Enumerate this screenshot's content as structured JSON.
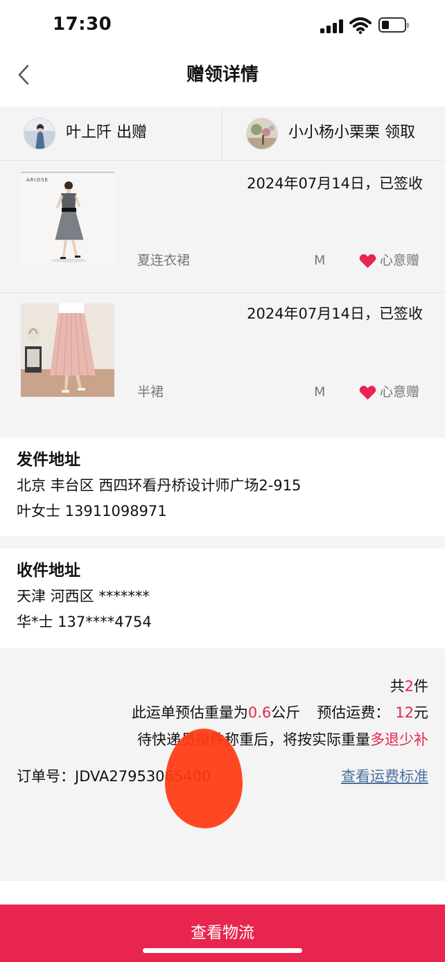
{
  "status_bar": {
    "time": "17:30"
  },
  "nav": {
    "title": "赠领详情"
  },
  "parties": {
    "giver": "叶上阡 出赠",
    "receiver": "小小杨小栗栗 领取"
  },
  "products": [
    {
      "date_status": "2024年07月14日，已签收",
      "name": "夏连衣裙",
      "size": "M",
      "tag": "心意赠",
      "image_brand": "ARIOSE"
    },
    {
      "date_status": "2024年07月14日，已签收",
      "name": "半裙",
      "size": "M",
      "tag": "心意赠"
    }
  ],
  "sender_address": {
    "title": "发件地址",
    "line1": "北京 丰台区 西四环看丹桥设计师广场2-915",
    "line2": "叶女士 13911098971"
  },
  "receiver_address": {
    "title": "收件地址",
    "line1": "天津 河西区 *******",
    "line2": "华*士 137****4754"
  },
  "summary": {
    "count_prefix": "共",
    "count": "2",
    "count_suffix": "件",
    "weight_prefix": "此运单预估重量为",
    "weight": "0.6",
    "weight_unit": "公斤",
    "fee_label": "预估运费：",
    "fee": "12",
    "fee_unit": "元",
    "note_prefix": "待快递员揽件称重后，将按实际重量",
    "note_highlight": "多退少补",
    "order_label": "订单号：",
    "order_no": "JDVA27953065400",
    "fee_standard_link": "查看运费标准"
  },
  "bottom_button": {
    "label": "查看物流"
  },
  "colors": {
    "accent": "#e8254f",
    "link": "#4b6e9c",
    "background_gray": "#f4f4f4"
  },
  "icons": [
    "back-arrow-icon",
    "heart-icon",
    "signal-icon",
    "wifi-icon",
    "battery-icon"
  ]
}
